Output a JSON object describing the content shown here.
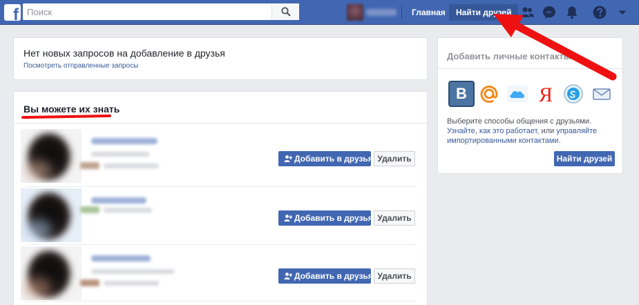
{
  "topbar": {
    "logo_letter": "f",
    "search_placeholder": "Поиск",
    "nav_home": "Главная",
    "nav_find_friends": "Найти друзей",
    "icons": [
      "friend-requests-icon",
      "messenger-icon",
      "notifications-icon",
      "help-icon",
      "dropdown-caret-icon"
    ]
  },
  "requests": {
    "title": "Нет новых запросов на добавление в друзья",
    "link": "Посмотреть отправленные запросы"
  },
  "pymk": {
    "title": "Вы можете их знать",
    "rows": [
      {
        "add_label": "Добавить в друзья",
        "delete_label": "Удалить"
      },
      {
        "add_label": "Добавить в друзья",
        "delete_label": "Удалить"
      },
      {
        "add_label": "Добавить в друзья",
        "delete_label": "Удалить"
      }
    ]
  },
  "contacts": {
    "title": "Добавить личные контакты",
    "services": [
      "vk-icon",
      "mail-ru-icon",
      "icloud-icon",
      "yandex-icon",
      "skype-icon",
      "email-icon"
    ],
    "vk_letter": "В",
    "yandex_letter": "Я",
    "text_intro": "Выберите способы общения с друзьями.",
    "link_how": "Узнайте, как это работает",
    "text_or": ", или",
    "link_manage": "управляйте импортированными контактами",
    "text_end": ".",
    "find_button": "Найти друзей"
  },
  "colors": {
    "brand_blue": "#4267b2",
    "link_blue": "#365899",
    "annotation_red": "#ee1111"
  }
}
